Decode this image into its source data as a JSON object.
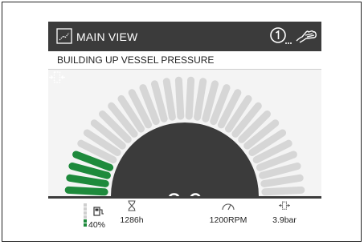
{
  "header": {
    "title": "MAIN VIEW",
    "view_icon": "main-view-icon",
    "info_icon": "info-one-icon",
    "hand_icon": "hand-icon"
  },
  "status": {
    "message": "BUILDING UP VESSEL PRESSURE"
  },
  "gauge": {
    "value": "3.9",
    "icon": "vessel-pressure-icon",
    "level": 0.13,
    "segments_total": 30,
    "segments_active": 4,
    "active_color": "#1e8a3c",
    "inactive_color": "#d6d6d6"
  },
  "readouts": {
    "fuel": {
      "icon": "fuel-pump-icon",
      "value": "40%",
      "level": 0.4
    },
    "hours": {
      "icon": "hourglass-icon",
      "value": "1286h"
    },
    "rpm": {
      "icon": "speedometer-icon",
      "value": "1200RPM"
    },
    "pressure": {
      "icon": "vessel-pressure-icon",
      "value": "3.9bar"
    }
  },
  "colors": {
    "header_bg": "#3b3b3b",
    "accent_green": "#1e8a3c",
    "gauge_bg": "#f4f4f4"
  }
}
